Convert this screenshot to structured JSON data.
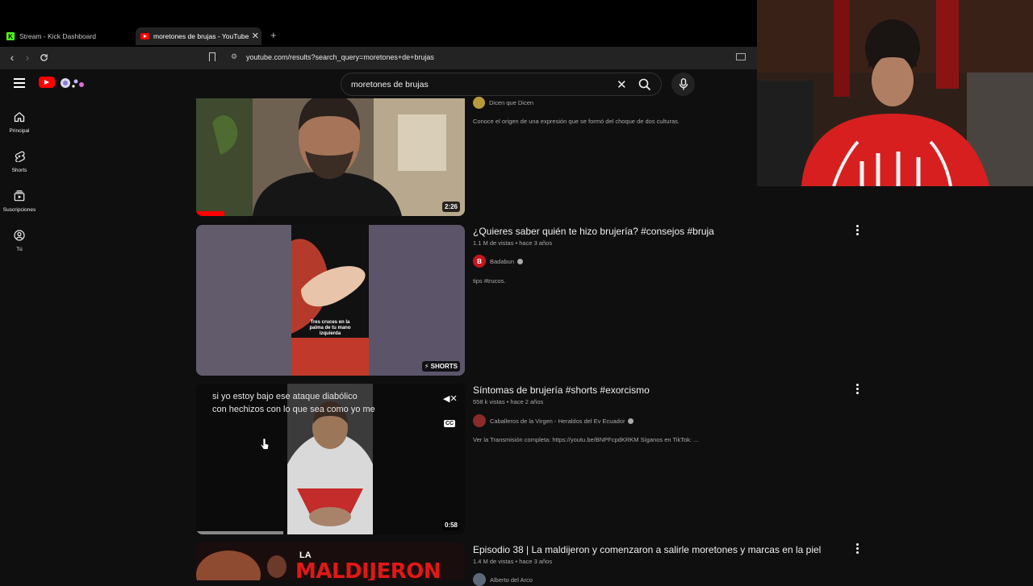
{
  "browser": {
    "tabs": [
      {
        "title": "Stream - Kick Dashboard"
      },
      {
        "title": "moretones de brujas - YouTube"
      }
    ],
    "new_tab": "+",
    "url": "youtube.com/results?search_query=moretones+de+brujas"
  },
  "youtube": {
    "search": {
      "query": "moretones de brujas"
    },
    "guide": [
      {
        "label": "Principal",
        "icon": "home-icon"
      },
      {
        "label": "Shorts",
        "icon": "shorts-icon"
      },
      {
        "label": "Suscripciones",
        "icon": "subscriptions-icon"
      },
      {
        "label": "Tú",
        "icon": "account-icon"
      }
    ],
    "results": [
      {
        "channel": "Dicen que Dicen",
        "description": "Conoce el origen de una expresión que se formó del choque de dos culturas.",
        "duration": "2:26"
      },
      {
        "title": "¿Quieres saber quién te hizo brujería? #consejos #bruja",
        "meta": "1.1 M de vistas • hace 3 años",
        "channel": "Badabun",
        "description": "tips #trucos.",
        "badge": "SHORTS",
        "thumb_caption": "Tres cruces en la palma de tu mano izquierda"
      },
      {
        "title": "Síntomas de brujería #shorts #exorcismo",
        "meta": "558 k vistas • hace 2 años",
        "channel": "Caballeros de la Virgen - Heraldos del Ev Ecuador",
        "description": "Ver la Transmisión completa: https://youtu.be/BNPFcpdKRKM Síganos en TikTok: ...",
        "duration": "0:58",
        "subtitle": "si yo estoy bajo ese ataque diabólico\ncon hechizos con lo que sea como yo me",
        "cc": "CC"
      },
      {
        "title": "Episodio 38 | La maldijeron y comenzaron a salirle moretones y marcas en la piel",
        "meta": "1.4 M de vistas • hace 3 años",
        "channel": "Alberto del Arco",
        "thumb_text_small": "LA",
        "thumb_text_big": "MALDIJERON"
      }
    ]
  },
  "colors": {
    "accent": "#ff0000",
    "background": "#0f0f0f",
    "kick": "#53fc18"
  }
}
